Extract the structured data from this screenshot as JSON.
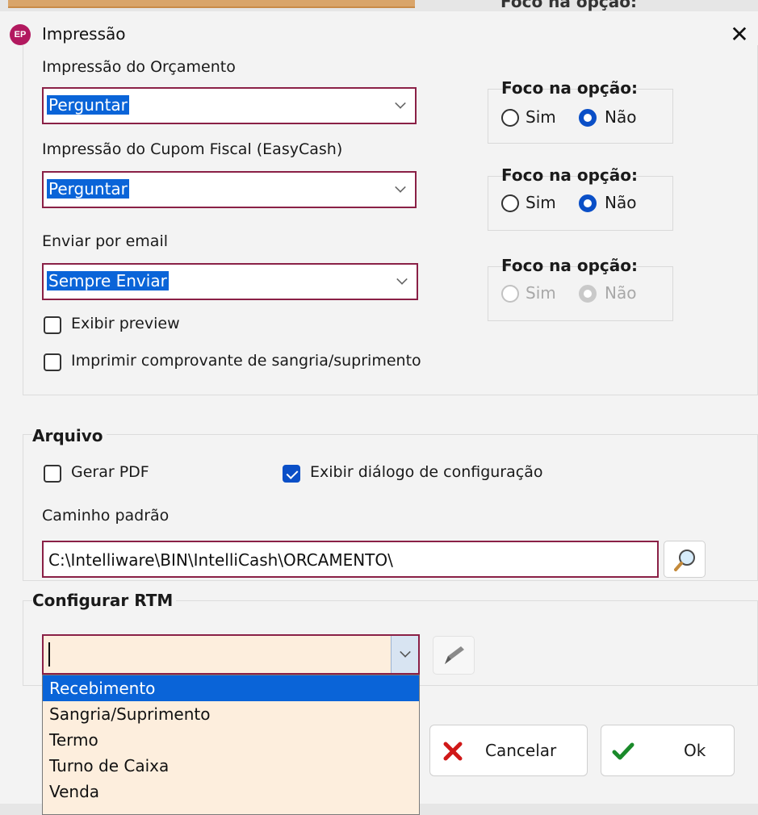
{
  "window": {
    "title": "Impressão",
    "app_icon_text": "EP",
    "close_glyph": "✕"
  },
  "background": {
    "partial_text": "Foco na opção:"
  },
  "print": {
    "orcamento": {
      "label": "Impressão do Orçamento",
      "value": "Perguntar"
    },
    "cupom": {
      "label": "Impressão do Cupom Fiscal (EasyCash)",
      "value": "Perguntar"
    },
    "email": {
      "label": "Enviar por email",
      "value": "Sempre Enviar"
    },
    "focus": [
      {
        "title": "Foco na opção:",
        "sim": "Sim",
        "nao": "Não",
        "selected": "nao",
        "enabled": true
      },
      {
        "title": "Foco na opção:",
        "sim": "Sim",
        "nao": "Não",
        "selected": "nao",
        "enabled": true
      },
      {
        "title": "Foco na opção:",
        "sim": "Sim",
        "nao": "Não",
        "selected": "nao",
        "enabled": false
      }
    ],
    "exibir_preview": {
      "label": "Exibir preview",
      "checked": false
    },
    "imprimir_comprovante": {
      "label": "Imprimir comprovante de sangria/suprimento",
      "checked": false
    }
  },
  "arquivo": {
    "title": "Arquivo",
    "gerar_pdf": {
      "label": "Gerar PDF",
      "checked": false
    },
    "exibir_dialogo": {
      "label": "Exibir diálogo de configuração",
      "checked": true
    },
    "caminho_label": "Caminho padrão",
    "caminho_value": "C:\\Intelliware\\BIN\\IntelliCash\\ORCAMENTO\\"
  },
  "rtm": {
    "title": "Configurar RTM",
    "value": "",
    "options": [
      "Recebimento",
      "Sangria/Suprimento",
      "Termo",
      "Turno de Caixa",
      "Venda"
    ],
    "highlighted": "Recebimento"
  },
  "buttons": {
    "cancel": "Cancelar",
    "ok": "Ok"
  },
  "colors": {
    "accent": "#0a64d8",
    "border": "#8a2046",
    "cancel_x": "#d01818",
    "ok_check": "#1a8a2a"
  }
}
